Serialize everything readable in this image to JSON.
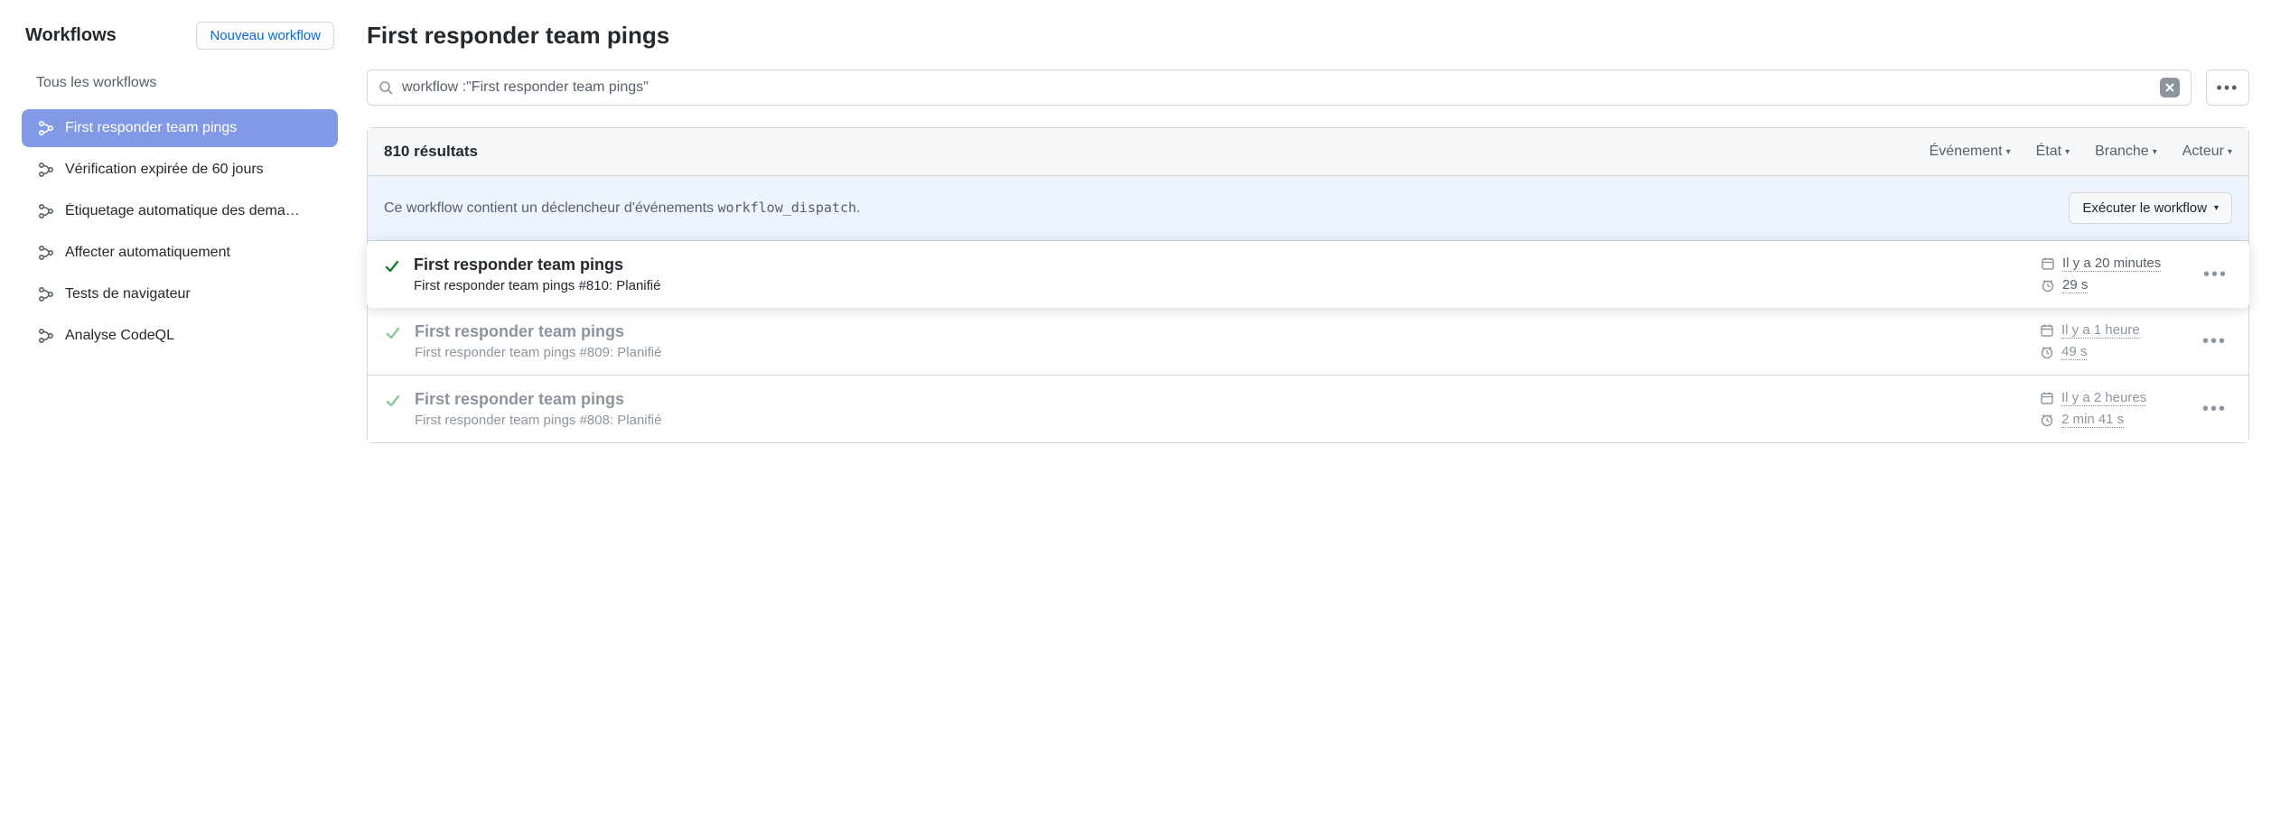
{
  "sidebar": {
    "title": "Workflows",
    "new_label": "Nouveau workflow",
    "all_label": "Tous les workflows",
    "items": [
      {
        "label": "First responder team pings",
        "active": true
      },
      {
        "label": "Vérification expirée de 60 jours",
        "active": false
      },
      {
        "label": "Étiquetage automatique des dema…",
        "active": false
      },
      {
        "label": "Affecter automatiquement",
        "active": false
      },
      {
        "label": "Tests de navigateur",
        "active": false
      },
      {
        "label": "Analyse CodeQL",
        "active": false
      }
    ]
  },
  "main": {
    "title": "First responder team pings",
    "search_value": "workflow :\"First responder team pings\"",
    "results_count": "810 résultats",
    "filters": {
      "event": "Événement",
      "status": "État",
      "branch": "Branche",
      "actor": "Acteur"
    },
    "dispatch": {
      "prefix": "Ce workflow contient un déclencheur d'événements ",
      "code": "workflow_dispatch",
      "suffix": ".",
      "run_label": "Exécuter le workflow"
    },
    "runs": [
      {
        "title": "First responder team pings",
        "subtitle": "First responder team pings #810: Planifié",
        "time": "Il y a 20 minutes",
        "duration": "29 s",
        "highlighted": true
      },
      {
        "title": "First responder team pings",
        "subtitle": "First responder team pings #809: Planifié",
        "time": "Il y a 1 heure",
        "duration": "49 s",
        "highlighted": false
      },
      {
        "title": "First responder team pings",
        "subtitle": "First responder team pings #808: Planifié",
        "time": "Il y a 2 heures",
        "duration": "2 min 41 s",
        "highlighted": false
      }
    ]
  }
}
